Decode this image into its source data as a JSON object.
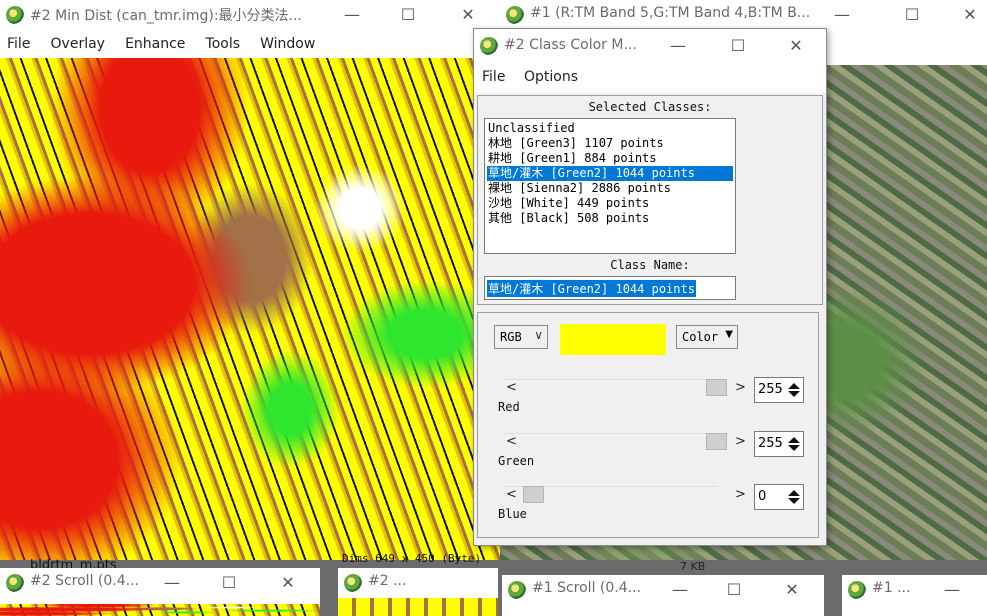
{
  "win_mindist": {
    "title": "#2 Min Dist (can_tmr.img):最小分类法...",
    "menu": [
      "File",
      "Overlay",
      "Enhance",
      "Tools",
      "Window"
    ]
  },
  "win_band": {
    "title": "#1 (R:TM Band 5,G:TM Band 4,B:TM B..."
  },
  "dialog": {
    "title": "#2 Class Color M...",
    "menu": [
      "File",
      "Options"
    ],
    "selected_classes_label": "Selected Classes:",
    "classes": [
      "Unclassified",
      "林地 [Green3] 1107 points",
      "耕地 [Green1] 884 points",
      "草地/灌木 [Green2] 1044 points",
      "裸地 [Sienna2] 2886 points",
      "沙地 [White] 449 points",
      "其他 [Black] 508 points"
    ],
    "selected_index": 3,
    "class_name_label": "Class Name:",
    "class_name_value": "草地/灌木 [Green2] 1044 points",
    "color_system": "RGB",
    "color_menu": "Color",
    "swatch_color": "#ffff00",
    "sliders": [
      {
        "label": "Red",
        "value": "255",
        "level": 1.0
      },
      {
        "label": "Green",
        "value": "255",
        "level": 1.0
      },
      {
        "label": "Blue",
        "value": "0",
        "level": 0.0
      }
    ]
  },
  "bottom": {
    "partial_text": "bldrtm_m.pts",
    "dims_text": "Dims 649 x 450 (Byte)",
    "kb_text": "7 KB",
    "scroll2_title": "#2 Scroll (0.4...",
    "zoom2_title": "#2 ...",
    "scroll1_title": "#1 Scroll (0.4...",
    "win1_title": "#1 ..."
  },
  "controls": {
    "minimize": "—",
    "maximize": "☐",
    "close": "✕"
  },
  "colors": {
    "selection": "#0078d7",
    "yellow": "#ffff00"
  }
}
